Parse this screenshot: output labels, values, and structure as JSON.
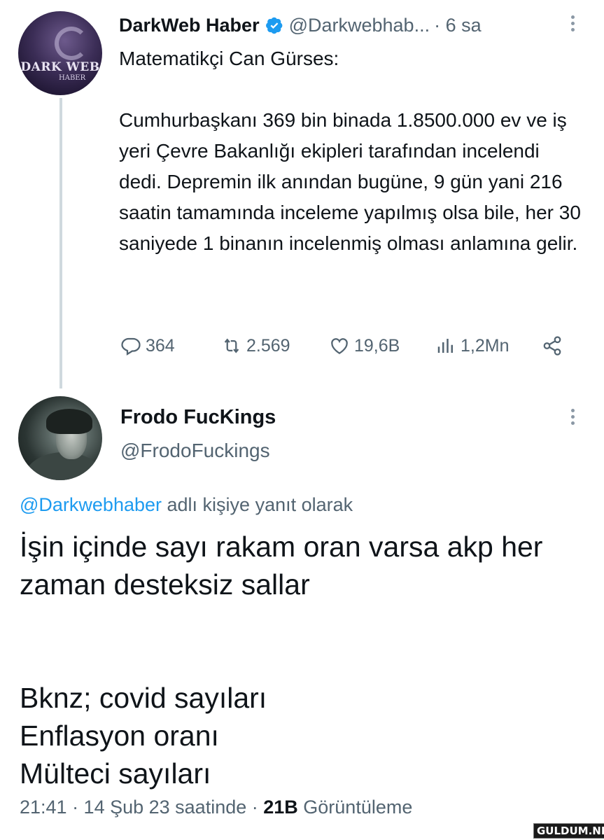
{
  "parent_tweet": {
    "avatar_text": "DARK WEB",
    "avatar_subtext": "HABER",
    "display_name": "DarkWeb Haber",
    "verified_icon": "verified-badge-icon",
    "handle": "@Darkwebhab...",
    "time": "· 6 sa",
    "text": "Matematikçi Can Gürses:\n\nCumhurbaşkanı 369 bin binada 1.8500.000 ev ve iş yeri Çevre Bakanlığı ekipleri tarafından incelendi dedi. Depremin ilk anından bugüne, 9 gün yani 216 saatin tamamında inceleme yapılmış olsa bile, her 30 saniyede 1 binanın incelenmiş olması anlamına gelir.",
    "actions": {
      "replies": "364",
      "retweets": "2.569",
      "likes": "19,6B",
      "views": "1,2Mn"
    }
  },
  "reply_tweet": {
    "display_name": "Frodo FucKings",
    "handle": "@FrodoFuckings",
    "replying_mention": "@Darkwebhaber",
    "replying_suffix": " adlı kişiye yanıt olarak",
    "text": "İşin içinde sayı rakam oran varsa akp her zaman desteksiz sallar\n\n\nBknz; covid sayıları\nEnflasyon oranı\nMülteci sayıları",
    "timestamp": "21:41 · 14 Şub 23 saatinde · ",
    "views_count": "21B",
    "views_label": " Görüntüleme"
  },
  "watermark": "GULDUM.NET",
  "colors": {
    "text": "#0f1419",
    "secondary": "#536471",
    "accent": "#1d9bf0",
    "thread_line": "#cfd9de"
  }
}
